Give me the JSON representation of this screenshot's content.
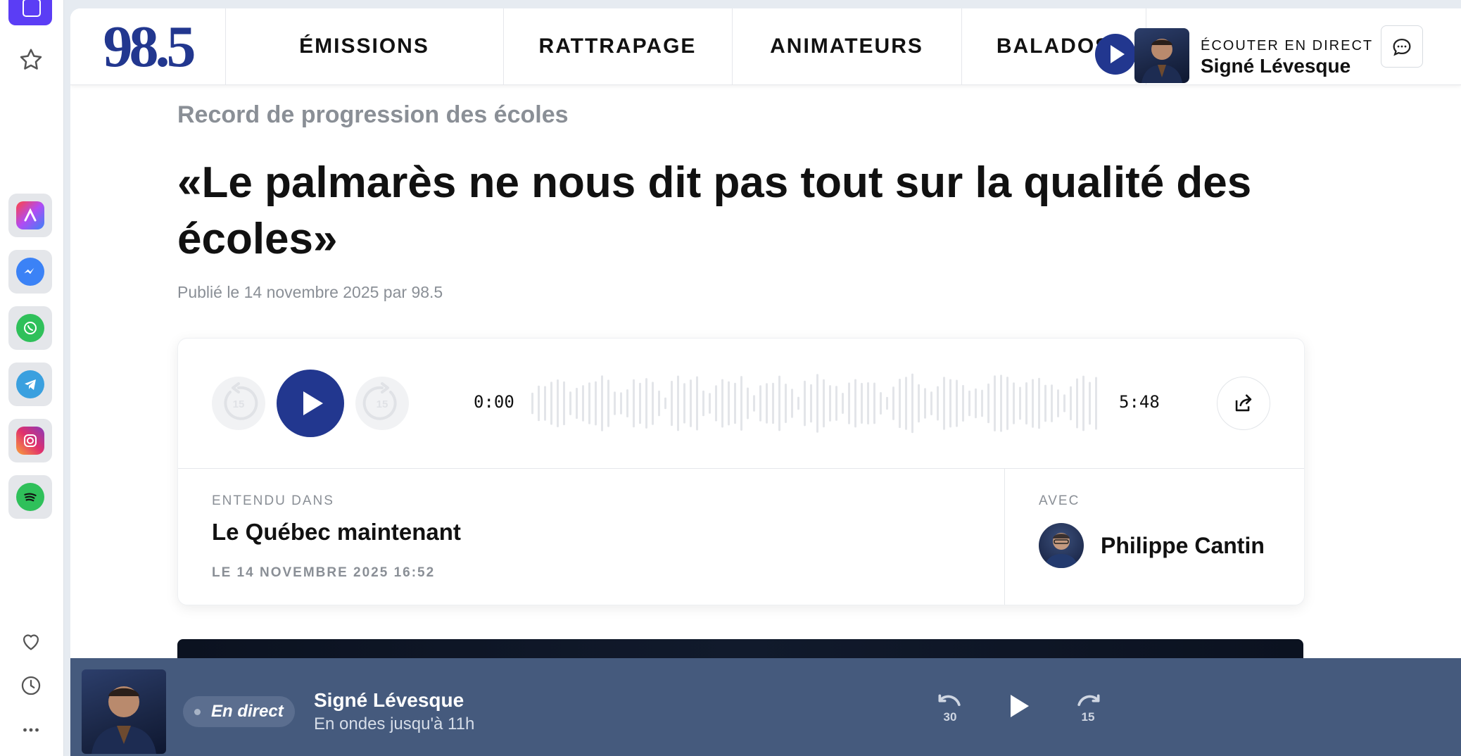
{
  "nav": {
    "logo": "98.5",
    "items": [
      {
        "label": "ÉMISSIONS"
      },
      {
        "label": "RATTRAPAGE"
      },
      {
        "label": "ANIMATEURS"
      },
      {
        "label": "BALADOS"
      }
    ],
    "live_kicker": "ÉCOUTER EN DIRECT",
    "live_name": "Signé Lévesque"
  },
  "article": {
    "kicker": "Record de progression des écoles",
    "headline": "«Le palmarès ne nous dit pas tout sur la qualité des écoles»",
    "byline": "Publié le 14 novembre 2025 par 98.5"
  },
  "player": {
    "skip_back": "15",
    "skip_forward": "15",
    "current_time": "0:00",
    "duration": "5:48",
    "progress": 0
  },
  "episode": {
    "heard_in_label": "ENTENDU DANS",
    "show": "Le Québec maintenant",
    "date": "LE 14 NOVEMBRE 2025 16:52",
    "with_label": "AVEC",
    "host": "Philippe Cantin"
  },
  "livebar": {
    "badge": "En direct",
    "title": "Signé Lévesque",
    "subtitle": "En ondes jusqu'à 11h",
    "rewind": "30",
    "forward": "15"
  },
  "colors": {
    "brand": "#22378f",
    "livebar": "#455a7d"
  }
}
